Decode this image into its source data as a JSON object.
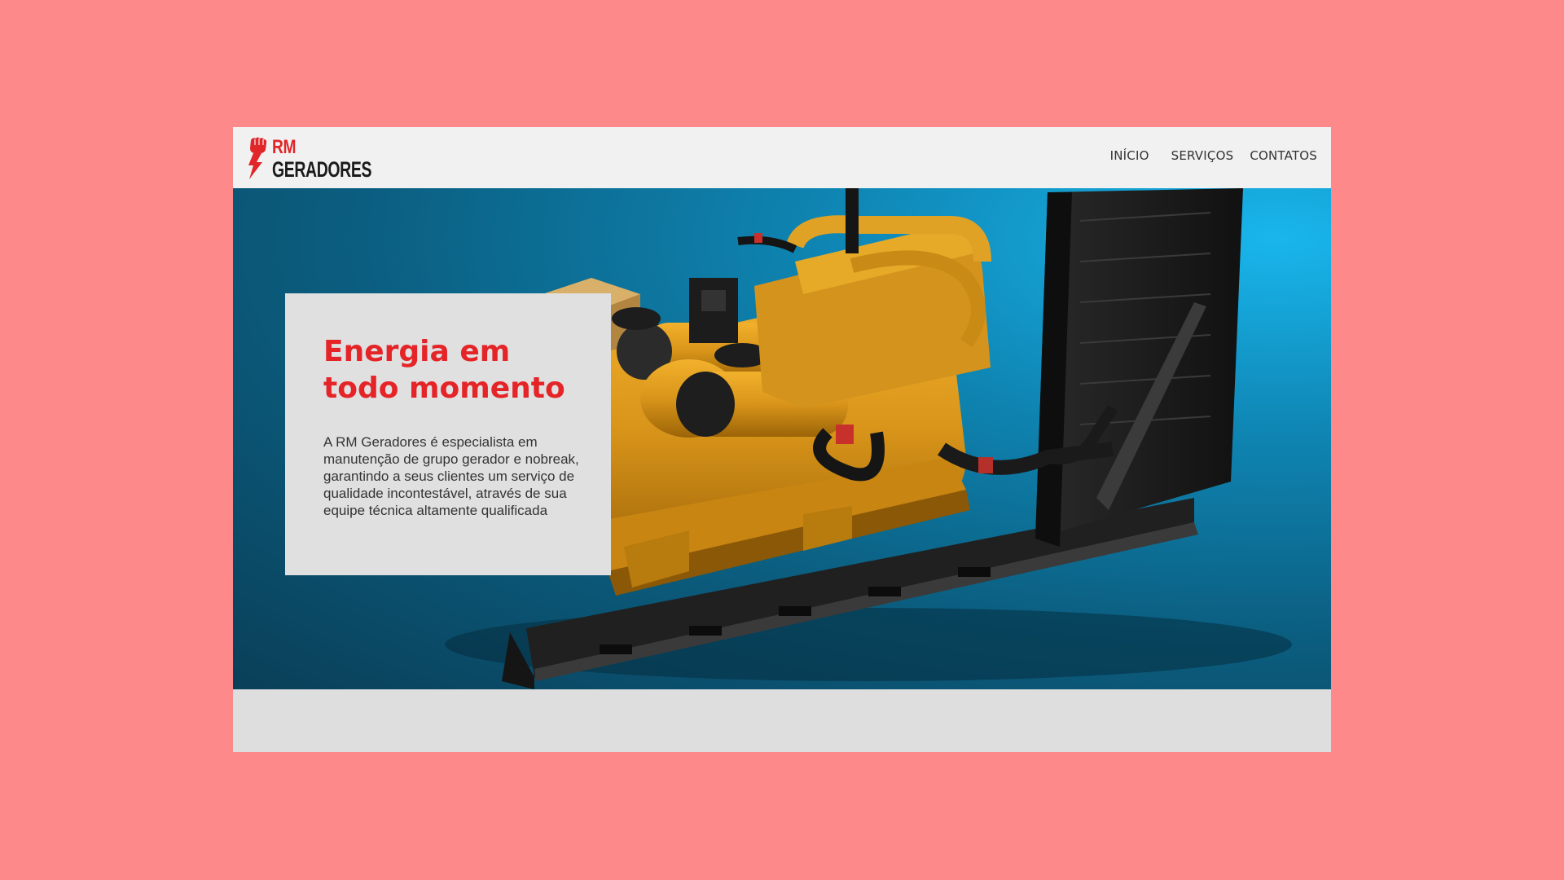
{
  "logo": {
    "line1": "RM",
    "line2": "GERADORES",
    "icon": "fist-lightning-icon",
    "brand_red": "#e1262a"
  },
  "nav": {
    "items": [
      {
        "label": "INÍCIO"
      },
      {
        "label": "SERVIÇOS"
      },
      {
        "label": "CONTATOS"
      }
    ]
  },
  "hero": {
    "image": "yellow-diesel-generator",
    "title": "Energia em todo momento",
    "description": "A RM Geradores é especialista em manutenção de grupo gerador e nobreak, garantindo a seus clientes um serviço de qualidade incontestável, através de sua equipe técnica altamente qualificada"
  },
  "colors": {
    "page_background": "#fd898b",
    "accent": "#e52428",
    "hero_blue": "#0f86b4"
  }
}
